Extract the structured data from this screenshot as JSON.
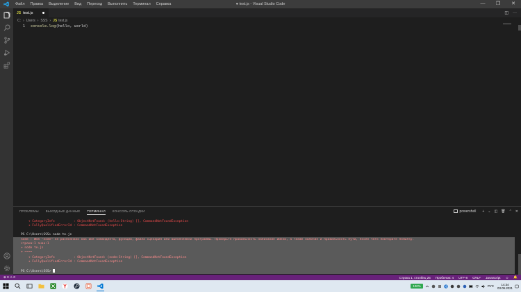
{
  "window": {
    "menu": [
      "Файл",
      "Правка",
      "Выделение",
      "Вид",
      "Переход",
      "Выполнить",
      "Терминал",
      "Справка"
    ],
    "title": "● test.js - Visual Studio Code",
    "controls": [
      "—",
      "❐",
      "✕"
    ]
  },
  "tab": {
    "icon": "JS",
    "name": "test.js",
    "modified": true
  },
  "breadcrumb": [
    "C:",
    "Users",
    "SSS",
    "JS",
    "test.js"
  ],
  "editor": {
    "line_number": "1",
    "code_fn": "console.log",
    "code_rest": "(hello, world)"
  },
  "panel": {
    "tabs": [
      "ПРОБЛЕМЫ",
      "ВЫХОДНЫЕ ДАННЫЕ",
      "ТЕРМИНАЛ",
      "КОНСОЛЬ ОТЛАДКИ"
    ],
    "active_tab": "ТЕРМИНАЛ",
    "shell": "powershell",
    "actions": [
      "+",
      "⌄",
      "◫",
      "🗑",
      "⌃",
      "✕"
    ]
  },
  "terminal": {
    "lines": [
      {
        "text": "    + CategoryInfo          : ObjectNotFound: (hello:String) [], CommandNotFoundException",
        "style": "red"
      },
      {
        "text": "    + FullyQualifiedErrorId : CommandNotFoundException",
        "style": "red"
      },
      {
        "text": "PS C:\\Users\\SSS> node te.js",
        "style": "white"
      },
      {
        "text": "node : Имя \"node\" не распознано как имя командлета, функции, файла сценария или выполняемой программы. Проверьте правильность написания имени, а также наличие и правильность пути, после чего повторите попытку.",
        "style": "sel"
      },
      {
        "text": "строка:1 знак:1",
        "style": "sel"
      },
      {
        "text": "+ node te.js",
        "style": "sel"
      },
      {
        "text": "+ ~~~~",
        "style": "sel"
      },
      {
        "text": "    + CategoryInfo          : ObjectNotFound: (node:String) [], CommandNotFoundException",
        "style": "sel"
      },
      {
        "text": "    + FullyQualifiedErrorId : CommandNotFoundException",
        "style": "sel"
      },
      {
        "text": "PS C:\\Users\\SSS> ",
        "style": "white"
      }
    ]
  },
  "statusbar": {
    "errors": "0",
    "warnings": "0",
    "position": "Строка 1, столбец 25",
    "spaces": "Пробелов: 4",
    "encoding": "UTF-8",
    "eol": "CRLF",
    "language": "JavaScript"
  },
  "taskbar": {
    "battery": "100%",
    "lang": "РУС",
    "time": "14:34",
    "date": "03.09.2021"
  },
  "colors": {
    "statusbar": "#68217a",
    "editor_bg": "#1e1e1e",
    "terminal_error": "#f14c4c"
  }
}
